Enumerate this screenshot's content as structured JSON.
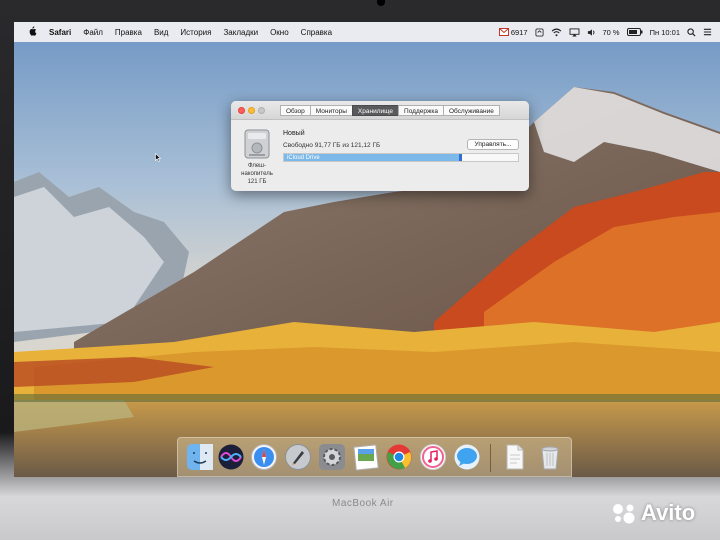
{
  "menubar": {
    "app_name": "Safari",
    "menus": [
      "Файл",
      "Правка",
      "Вид",
      "История",
      "Закладки",
      "Окно",
      "Справка"
    ],
    "mail_count": "6917",
    "battery": "70 %",
    "time": "Пн 10:01"
  },
  "about_window": {
    "tabs": [
      "Обзор",
      "Мониторы",
      "Хранилище",
      "Поддержка",
      "Обслуживание"
    ],
    "active_tab": "Хранилище",
    "drive_label_line1": "Флеш-",
    "drive_label_line2": "накопитель",
    "drive_label_line3": "121 ГБ",
    "disk_name": "Новый",
    "free_text": "Свободно 91,77 ГБ из 121,12 ГБ",
    "manage_button": "Управлять...",
    "bar_segment_label": "iCloud Drive",
    "used_fraction": 0.76
  },
  "dock": {
    "icons": [
      "finder-icon",
      "siri-icon",
      "safari-icon",
      "launchpad-icon",
      "system-preferences-icon",
      "preview-icon",
      "chrome-icon",
      "itunes-icon",
      "messages-icon",
      "document-icon",
      "trash-icon"
    ]
  },
  "hardware": {
    "model_label": "MacBook Air"
  },
  "watermark": {
    "text": "Avito"
  }
}
